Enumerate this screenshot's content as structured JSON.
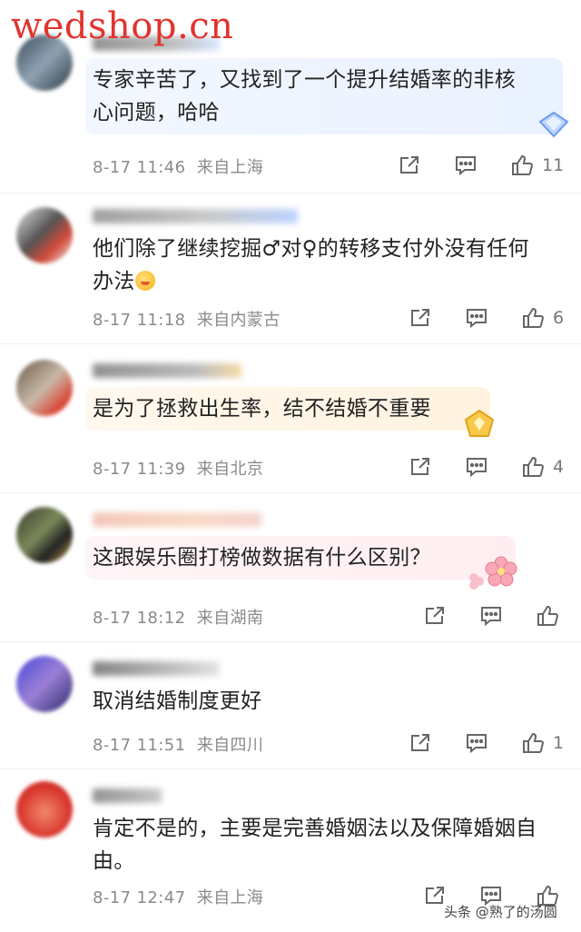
{
  "watermark": {
    "text": "wedshop.cn"
  },
  "comments": [
    {
      "text_line1": "专家辛苦了，又找到了一个提升结婚率的非核",
      "text_line2": "心问题，哈哈",
      "time": "8-17 11:46",
      "location": "来自上海",
      "likes": "11"
    },
    {
      "text_line1": "他们除了继续挖掘♂对♀的转移支付外没有任何",
      "text_line2": "办法",
      "time": "8-17 11:18",
      "location": "来自内蒙古",
      "likes": "6"
    },
    {
      "text_line1": "是为了拯救出生率，结不结婚不重要",
      "time": "8-17 11:39",
      "location": "来自北京",
      "likes": "4"
    },
    {
      "text_line1": "这跟娱乐圈打榜做数据有什么区别？",
      "time": "8-17 18:12",
      "location": "来自湖南",
      "likes": ""
    },
    {
      "text_line1": "取消结婚制度更好",
      "time": "8-17 11:51",
      "location": "来自四川",
      "likes": "1"
    },
    {
      "text_line1": "肯定不是的，主要是完善婚姻法以及保障婚姻自",
      "text_line2": "由。",
      "time": "8-17 12:47",
      "location": "来自上海",
      "likes": ""
    }
  ],
  "footer": {
    "source_text": "头条 @熟了的汤圆"
  }
}
